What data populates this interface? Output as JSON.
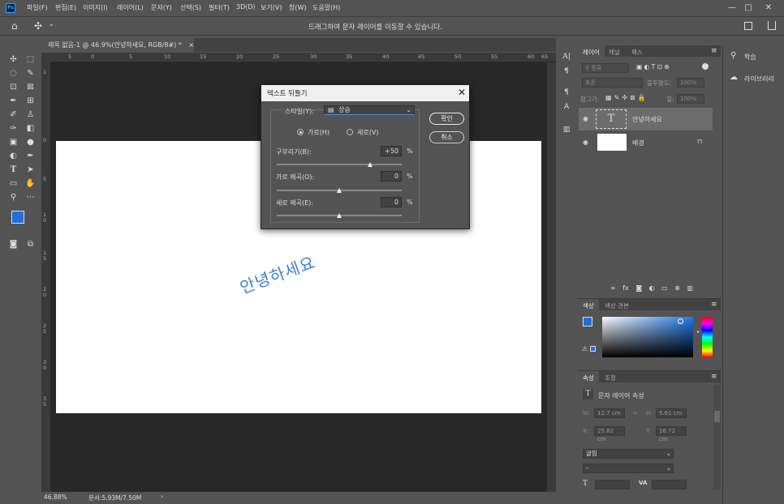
{
  "app": {
    "logo": "Ps"
  },
  "menu": [
    "파일(F)",
    "편집(E)",
    "이미지(I)",
    "레이어(L)",
    "문자(Y)",
    "선택(S)",
    "필터(T)",
    "3D(D)",
    "보기(V)",
    "창(W)",
    "도움말(H)"
  ],
  "window_controls": {
    "minimize": "—",
    "maximize": "□",
    "close": "✕"
  },
  "options_bar": {
    "home_icon": "⌂",
    "move_icon": "✣",
    "dropdown": "⌄",
    "hint": "드래그하여 문자 레이어를 이동할 수 있습니다."
  },
  "document": {
    "tab_title": "제목 없음-1 @ 46.9%(안녕하세요, RGB/8#) *",
    "tab_close": "×",
    "warp_text": "안녕하세요"
  },
  "ruler": {
    "h_labels": [
      "5",
      "0",
      "5",
      "10",
      "15",
      "20",
      "25",
      "30",
      "35",
      "40",
      "45",
      "50",
      "55",
      "60",
      "65"
    ],
    "v_labels": [
      "1",
      "0",
      "5",
      "1\n0",
      "1\n5",
      "2\n0",
      "2\n5",
      "3\n0",
      "3\n5"
    ]
  },
  "status": {
    "zoom": "46.88%",
    "doc": "문서:5.93M/7.50M",
    "arrow": "›"
  },
  "dialog": {
    "title": "텍스트 뒤틀기",
    "close": "✕",
    "style_label": "스타일(Y):",
    "style_value": "상승",
    "style_icon": "▤",
    "horizontal": "가로(H)",
    "vertical": "세로(V)",
    "bend_label": "구부리기(B):",
    "bend_value": "+50",
    "bend_fraction": 0.75,
    "hdist_label": "가로 왜곡(O):",
    "hdist_value": "0",
    "hdist_fraction": 0.5,
    "vdist_label": "세로 왜곡(E):",
    "vdist_value": "0",
    "vdist_fraction": 0.5,
    "percent": "%",
    "ok": "확인",
    "cancel": "취소"
  },
  "layers_panel": {
    "tabs": [
      "레이어",
      "채널",
      "패스"
    ],
    "filter_label": "종류",
    "blend_mode": "표준",
    "opacity_label": "불투명도:",
    "opacity_value": "100%",
    "lock_label": "잠그기:",
    "fill_label": "칠:",
    "fill_value": "100%",
    "layers": [
      {
        "name": "안녕하세요",
        "thumb": "T"
      },
      {
        "name": "배경",
        "lock": "🔒"
      }
    ],
    "eye_icon": "👁",
    "footer_icons": [
      "∞",
      "fx",
      "◙",
      "◐",
      "▭",
      "⊕",
      "🗑"
    ]
  },
  "color_panel": {
    "tabs": [
      "색상",
      "색상 견본"
    ],
    "fg_color": "#1f6fd6",
    "bg_color": "#ffffff"
  },
  "props_panel": {
    "tabs": [
      "속성",
      "조정"
    ],
    "type_icon": "T",
    "heading": "문자 레이어 속성",
    "w_label": "W:",
    "w_value": "12.7 cm",
    "h_label": "H:",
    "h_value": "5.61 cm",
    "x_label": "X:",
    "x_value": "25.82 cm",
    "y_label": "Y:",
    "y_value": "16.72 cm",
    "font": "굴림",
    "font_style": "-",
    "size_icon": "T",
    "tracking_icon": "VA"
  },
  "right_panel": {
    "learn": "학습",
    "libraries": "라이브러리"
  },
  "accent_colors": {
    "text_blue": "#3a7fd6",
    "fg": "#1f6fd6"
  }
}
